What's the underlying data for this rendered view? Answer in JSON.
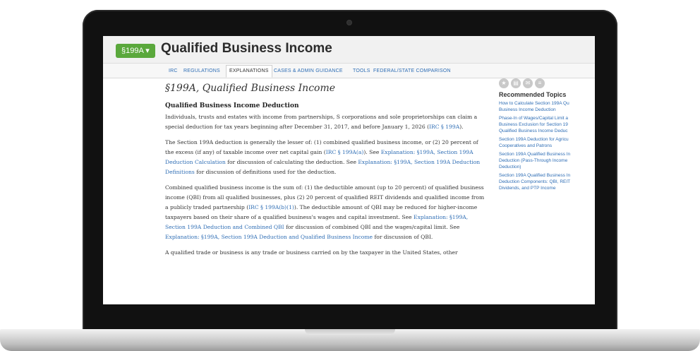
{
  "header": {
    "section_label": "§199A ▾",
    "title": "Qualified Business Income"
  },
  "tabs": [
    {
      "label": "IRC",
      "active": false
    },
    {
      "label": "REGULATIONS",
      "active": false
    },
    {
      "label": "EXPLANATIONS",
      "active": true
    },
    {
      "label": "CASES & ADMIN GUIDANCE",
      "active": false
    },
    {
      "label": "TOOLS",
      "active": false
    },
    {
      "label": "FEDERAL/STATE COMPARISON",
      "active": false
    }
  ],
  "document": {
    "title": "§199A, Qualified Business Income",
    "heading": "Qualified Business Income Deduction",
    "p1": {
      "text": "Individuals, trusts and estates with income from partnerships, S corporations and sole proprietorships can claim a special deduction for tax years beginning after December 31, 2017, and before January 1, 2026 (",
      "link": "IRC § 199A",
      "end": ")."
    },
    "p2": {
      "t1": "The Section 199A deduction is generally the lesser of: (1) combined qualified business income, or (2) 20 percent of the excess (if any) of taxable income over net capital gain (",
      "l1": "IRC § 199A(a)",
      "t2": "). See ",
      "l2": "Explanation: §199A, Section 199A Deduction Calculation",
      "t3": " for discussion of calculating the deduction. See ",
      "l3": "Explanation: §199A, Section 199A Deduction Definitions",
      "t4": " for discussion of definitions used for the deduction."
    },
    "p3": {
      "t1": "Combined qualified business income is the sum of: (1) the deductible amount (up to 20 percent) of qualified business income (QBI) from all qualified businesses, plus (2) 20 percent of qualified REIT dividends and qualified income from a publicly traded partnership (",
      "l1": "IRC § 199A(b)(1)",
      "t2": "). The deductible amount of QBI may be reduced for higher-income taxpayers based on their share of a qualified business's wages and capital investment. See ",
      "l2": "Explanation: §199A, Section 199A Deduction and Combined QBI",
      "t3": " for discussion of combined QBI and the wages/capital limit. See ",
      "l3": "Explanation: §199A, Section 199A Deduction and Qualified Business Income",
      "t4": " for discussion of QBI."
    },
    "p4": "A qualified trade or business is any trade or business carried on by the taxpayer in the United States, other"
  },
  "sidebar": {
    "icons": [
      "star-icon",
      "print-icon",
      "email-icon",
      "menu-icon"
    ],
    "title": "Recommended Topics",
    "items": [
      "How to Calculate Section 199A Qu\nBusiness Income Deduction",
      "Phase-In of Wages/Capital Limit a\nBusiness Exclusion for Section 19\nQualified Business Income Deduc",
      "Section 199A Deduction for Agricu\nCooperatives and Patrons",
      "Section 199A Qualified Business In\nDeduction (Pass-Through Income\nDeduction)",
      "Section 199A Qualified Business In\nDeduction Components: QBI, REIT\nDividends, and PTP Income"
    ]
  },
  "colors": {
    "brand_green": "#5aa83c",
    "link_blue": "#2f6eb5",
    "bezel": "#111111"
  }
}
